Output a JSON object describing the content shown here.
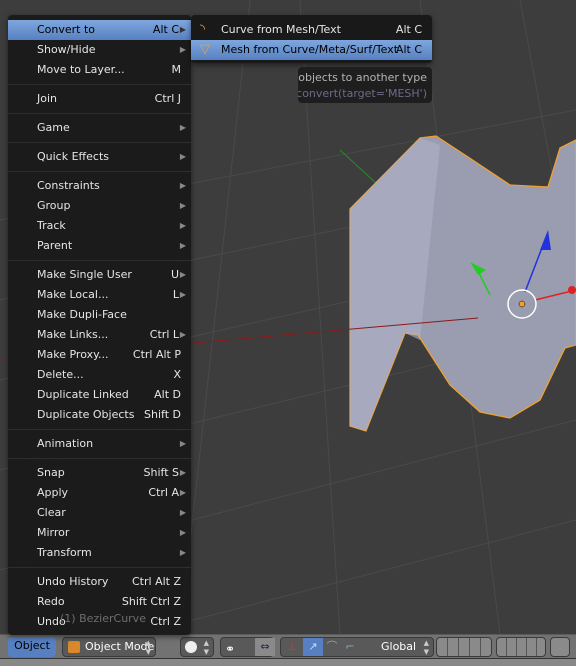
{
  "menu": {
    "items": [
      {
        "label": "Convert to",
        "shortcut": "Alt C",
        "submenu": true,
        "active": true
      },
      {
        "label": "Show/Hide",
        "shortcut": "",
        "submenu": true
      },
      {
        "label": "Move to Layer...",
        "shortcut": "M"
      },
      {
        "sep": true
      },
      {
        "label": "Join",
        "shortcut": "Ctrl J"
      },
      {
        "sep": true
      },
      {
        "label": "Game",
        "shortcut": "",
        "submenu": true
      },
      {
        "sep": true
      },
      {
        "label": "Quick Effects",
        "shortcut": "",
        "submenu": true
      },
      {
        "sep": true
      },
      {
        "label": "Constraints",
        "submenu": true
      },
      {
        "label": "Group",
        "submenu": true
      },
      {
        "label": "Track",
        "submenu": true
      },
      {
        "label": "Parent",
        "submenu": true
      },
      {
        "sep": true
      },
      {
        "label": "Make Single User",
        "shortcut": "U",
        "submenu": true
      },
      {
        "label": "Make Local...",
        "shortcut": "L",
        "submenu": true
      },
      {
        "label": "Make Dupli-Face",
        "shortcut": ""
      },
      {
        "label": "Make Links...",
        "shortcut": "Ctrl L",
        "submenu": true
      },
      {
        "label": "Make Proxy...",
        "shortcut": "Ctrl Alt P"
      },
      {
        "label": "Delete...",
        "shortcut": "X"
      },
      {
        "label": "Duplicate Linked",
        "shortcut": "Alt D"
      },
      {
        "label": "Duplicate Objects",
        "shortcut": "Shift D"
      },
      {
        "sep": true
      },
      {
        "label": "Animation",
        "submenu": true
      },
      {
        "sep": true
      },
      {
        "label": "Snap",
        "shortcut": "Shift S",
        "submenu": true
      },
      {
        "label": "Apply",
        "shortcut": "Ctrl A",
        "submenu": true
      },
      {
        "label": "Clear",
        "submenu": true
      },
      {
        "label": "Mirror",
        "submenu": true
      },
      {
        "label": "Transform",
        "submenu": true
      },
      {
        "sep": true
      },
      {
        "label": "Undo History",
        "shortcut": "Ctrl Alt Z"
      },
      {
        "label": "Redo",
        "shortcut": "Shift Ctrl Z"
      },
      {
        "label": "Undo",
        "shortcut": "Ctrl Z"
      }
    ]
  },
  "submenu": {
    "items": [
      {
        "label": "Curve from Mesh/Text",
        "shortcut": "Alt C",
        "icon": "curve-icon"
      },
      {
        "label": "Mesh from Curve/Meta/Surf/Text",
        "shortcut": "Alt C",
        "icon": "mesh-icon",
        "active": true
      }
    ]
  },
  "tooltip": {
    "description": "Convert selected objects to another type",
    "python": "Python: bpy.ops.object.convert(target='MESH')"
  },
  "viewport": {
    "object_name": "(1) BezierCurve"
  },
  "header": {
    "menu_label": "Object",
    "mode": "Object Mode",
    "orientation": "Global"
  },
  "colors": {
    "accent": "#5680c2",
    "selection": "#f0a030"
  }
}
